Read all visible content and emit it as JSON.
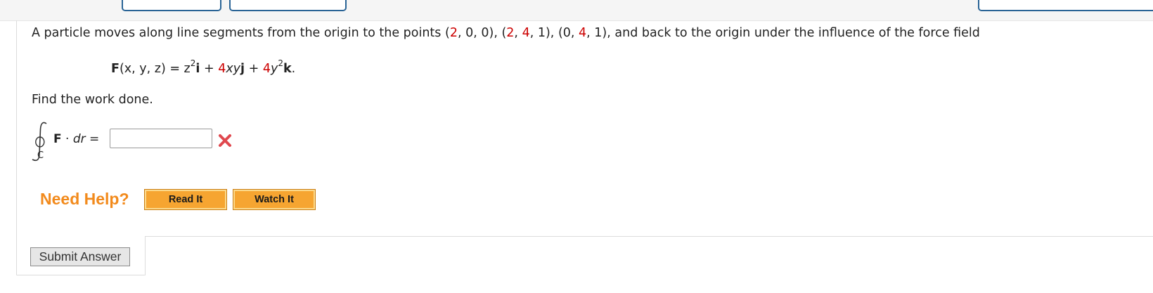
{
  "question": {
    "intro": "A particle moves along line segments from the origin to the points ",
    "p1": {
      "open": "(",
      "a": "2",
      "s1": ", 0, 0)",
      "sep": ", "
    },
    "p2": {
      "open": "(",
      "a": "2",
      "s1": ", ",
      "b": "4",
      "s2": ", 1)",
      "sep": ", "
    },
    "p3": {
      "open": "(0, ",
      "b": "4",
      "s2": ", 1)"
    },
    "outro": ", and back to the origin under the influence of the force field"
  },
  "formula": {
    "F": "F",
    "args": "(x, y, z) = z",
    "exp1": "2",
    "i": "i",
    "plus1": " + ",
    "coef1": "4",
    "xy": "xy",
    "j": "j",
    "plus2": " + ",
    "coef2": "4",
    "y": "y",
    "exp2": "2",
    "k": "k",
    "period": "."
  },
  "find_text": "Find the work done.",
  "integral": {
    "subscript": "C",
    "F": "F",
    "dot": " · ",
    "dr": "dr",
    "eq": " ="
  },
  "answer": {
    "value": "",
    "status": "incorrect"
  },
  "help": {
    "label": "Need Help?",
    "read_label": "Read It",
    "watch_label": "Watch It"
  },
  "submit_label": "Submit Answer",
  "colors": {
    "accent_red": "#cc0000",
    "help_orange": "#f28a1c",
    "button_orange": "#f6a531",
    "tab_border": "#2a6496"
  },
  "icons": {
    "wrong": "x-mark-icon",
    "integral": "contour-integral-icon"
  }
}
